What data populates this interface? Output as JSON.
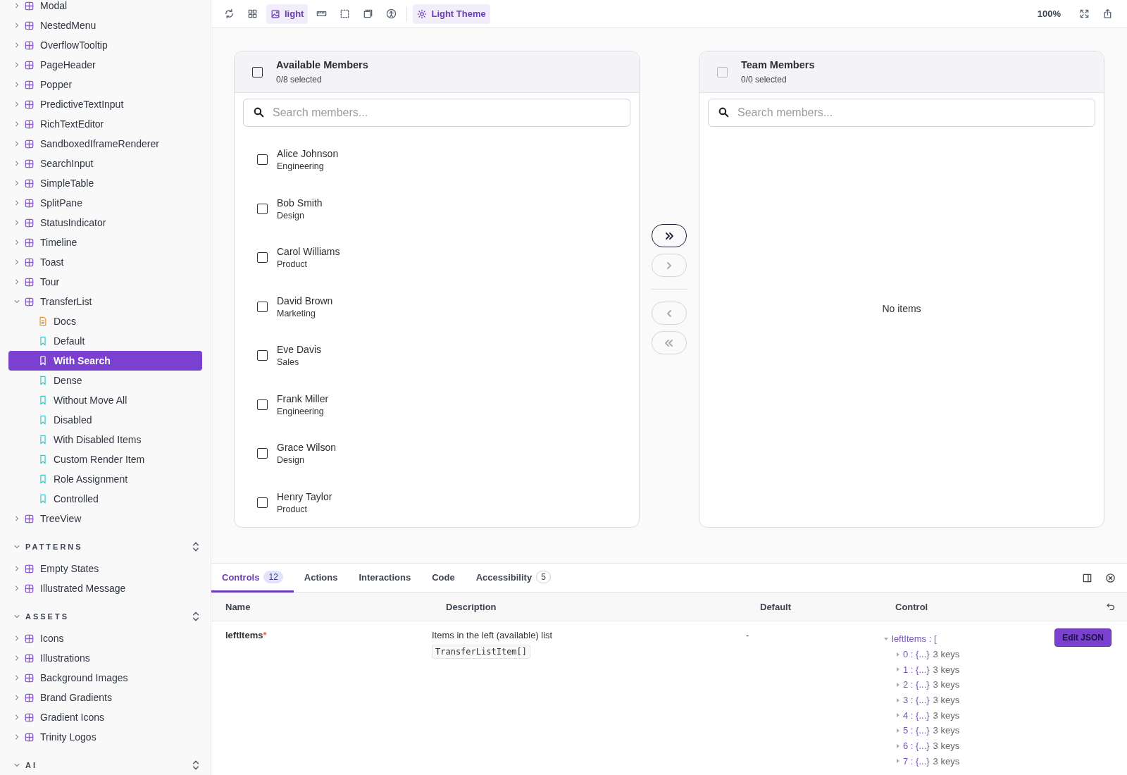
{
  "sidebar": {
    "sections": [
      {
        "items": [
          {
            "label": "Modal",
            "kind": "component",
            "expanded": false
          },
          {
            "label": "NestedMenu",
            "kind": "component",
            "expanded": false
          },
          {
            "label": "OverflowTooltip",
            "kind": "component",
            "expanded": false
          },
          {
            "label": "PageHeader",
            "kind": "component",
            "expanded": false
          },
          {
            "label": "Popper",
            "kind": "component",
            "expanded": false
          },
          {
            "label": "PredictiveTextInput",
            "kind": "component",
            "expanded": false
          },
          {
            "label": "RichTextEditor",
            "kind": "component",
            "expanded": false
          },
          {
            "label": "SandboxedIframeRenderer",
            "kind": "component",
            "expanded": false
          },
          {
            "label": "SearchInput",
            "kind": "component",
            "expanded": false
          },
          {
            "label": "SimpleTable",
            "kind": "component",
            "expanded": false
          },
          {
            "label": "SplitPane",
            "kind": "component",
            "expanded": false
          },
          {
            "label": "StatusIndicator",
            "kind": "component",
            "expanded": false
          },
          {
            "label": "Timeline",
            "kind": "component",
            "expanded": false
          },
          {
            "label": "Toast",
            "kind": "component",
            "expanded": false
          },
          {
            "label": "Tour",
            "kind": "component",
            "expanded": false
          },
          {
            "label": "TransferList",
            "kind": "component",
            "expanded": true,
            "children": [
              {
                "label": "Docs",
                "kind": "docs",
                "selected": false
              },
              {
                "label": "Default",
                "kind": "story",
                "selected": false
              },
              {
                "label": "With Search",
                "kind": "story",
                "selected": true
              },
              {
                "label": "Dense",
                "kind": "story",
                "selected": false
              },
              {
                "label": "Without Move All",
                "kind": "story",
                "selected": false
              },
              {
                "label": "Disabled",
                "kind": "story",
                "selected": false
              },
              {
                "label": "With Disabled Items",
                "kind": "story",
                "selected": false
              },
              {
                "label": "Custom Render Item",
                "kind": "story",
                "selected": false
              },
              {
                "label": "Role Assignment",
                "kind": "story",
                "selected": false
              },
              {
                "label": "Controlled",
                "kind": "story",
                "selected": false
              }
            ]
          },
          {
            "label": "TreeView",
            "kind": "component",
            "expanded": false
          }
        ]
      },
      {
        "title": "PATTERNS",
        "expanded": true,
        "items": [
          {
            "label": "Empty States",
            "kind": "component",
            "expanded": false
          },
          {
            "label": "Illustrated Message",
            "kind": "component",
            "expanded": false
          }
        ]
      },
      {
        "title": "ASSETS",
        "expanded": true,
        "items": [
          {
            "label": "Icons",
            "kind": "component",
            "expanded": false
          },
          {
            "label": "Illustrations",
            "kind": "component",
            "expanded": false
          },
          {
            "label": "Background Images",
            "kind": "component",
            "expanded": false
          },
          {
            "label": "Brand Gradients",
            "kind": "component",
            "expanded": false
          },
          {
            "label": "Gradient Icons",
            "kind": "component",
            "expanded": false
          },
          {
            "label": "Trinity Logos",
            "kind": "component",
            "expanded": false
          }
        ]
      },
      {
        "title": "AI",
        "expanded": true
      }
    ]
  },
  "toolbar": {
    "tools": [
      {
        "kind": "reload",
        "active": false
      },
      {
        "kind": "grid",
        "active": false
      },
      {
        "kind": "background",
        "label": "light",
        "active": true
      },
      {
        "kind": "ruler",
        "active": false
      },
      {
        "kind": "outline",
        "active": false
      },
      {
        "kind": "viewport",
        "active": false
      },
      {
        "kind": "accessibility",
        "active": false
      },
      {
        "kind": "theme",
        "label": "Light Theme",
        "active": true
      }
    ],
    "zoom": "100%",
    "right_tools": [
      {
        "kind": "fullscreen"
      },
      {
        "kind": "share"
      }
    ]
  },
  "transfer": {
    "panels": [
      {
        "title": "Available Members",
        "count": "0/8 selected",
        "all_checked": false,
        "disabled": false,
        "search": {
          "placeholder": "Search members..."
        },
        "items": [
          {
            "name": "Alice Johnson",
            "department": "Engineering",
            "checked": false
          },
          {
            "name": "Bob Smith",
            "department": "Design",
            "checked": false
          },
          {
            "name": "Carol Williams",
            "department": "Product",
            "checked": false
          },
          {
            "name": "David Brown",
            "department": "Marketing",
            "checked": false
          },
          {
            "name": "Eve Davis",
            "department": "Sales",
            "checked": false
          },
          {
            "name": "Frank Miller",
            "department": "Engineering",
            "checked": false
          },
          {
            "name": "Grace Wilson",
            "department": "Design",
            "checked": false
          },
          {
            "name": "Henry Taylor",
            "department": "Product",
            "checked": false
          }
        ]
      },
      {
        "title": "Team Members",
        "count": "0/0 selected",
        "all_checked": false,
        "disabled": true,
        "search": {
          "placeholder": "Search members..."
        },
        "empty_text": "No items"
      }
    ],
    "move_buttons": [
      {
        "kind": "all-right",
        "disabled": false
      },
      {
        "kind": "right",
        "disabled": true
      },
      {
        "kind": "left",
        "disabled": true
      },
      {
        "kind": "all-left",
        "disabled": true
      }
    ]
  },
  "addons": {
    "tabs": [
      {
        "label": "Controls",
        "badge": "12",
        "selected": true
      },
      {
        "label": "Actions",
        "selected": false
      },
      {
        "label": "Interactions",
        "selected": false
      },
      {
        "label": "Code",
        "selected": false
      },
      {
        "label": "Accessibility",
        "badge": "5",
        "selected": false
      }
    ],
    "columns": [
      "Name",
      "Description",
      "Default",
      "Control"
    ],
    "rows": [
      {
        "name": "leftItems",
        "required_mark": "*",
        "description": "Items in the left (available) list",
        "type": "TransferListItem[]",
        "default": "-",
        "button": "Edit JSON",
        "control": {
          "label": "leftItems : [",
          "expanded": true,
          "entries": [
            {
              "key": "0 : {...}",
              "count": "3 keys",
              "expanded": false
            },
            {
              "key": "1 : {...}",
              "count": "3 keys",
              "expanded": false
            },
            {
              "key": "2 : {...}",
              "count": "3 keys",
              "expanded": false
            },
            {
              "key": "3 : {...}",
              "count": "3 keys",
              "expanded": false
            },
            {
              "key": "4 : {...}",
              "count": "3 keys",
              "expanded": false
            },
            {
              "key": "5 : {...}",
              "count": "3 keys",
              "expanded": false
            },
            {
              "key": "6 : {...}",
              "count": "3 keys",
              "expanded": false
            },
            {
              "key": "7 : {...}",
              "count": "3 keys",
              "expanded": false
            }
          ]
        }
      }
    ]
  }
}
